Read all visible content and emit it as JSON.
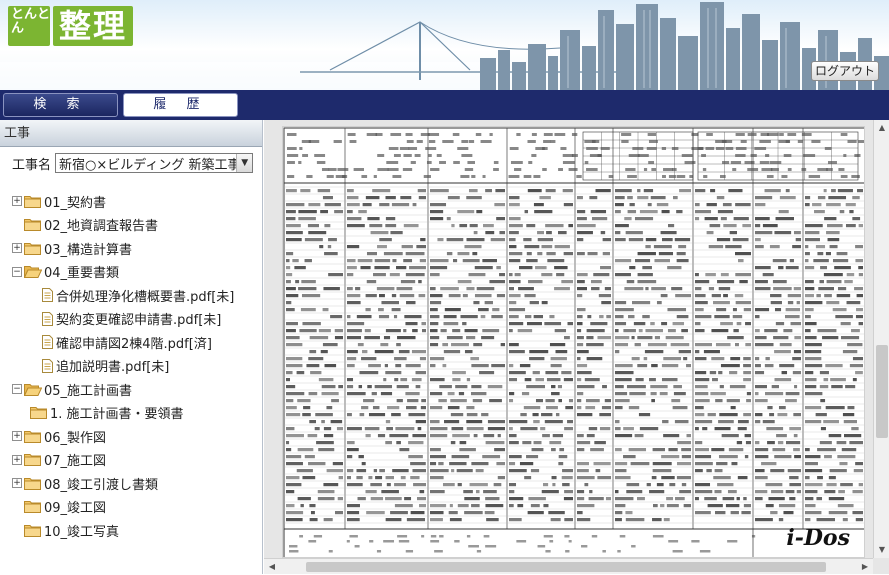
{
  "header": {
    "logo_sub": "とんとん",
    "logo_main": "整理",
    "logout_label": "ログアウト"
  },
  "tabs": {
    "search_label": "検 索",
    "history_label": "履 歴"
  },
  "panel": {
    "section_title": "工事",
    "project_label": "工事名",
    "project_value": "新宿○×ビルディング 新築工事"
  },
  "tree": [
    {
      "label": "01_契約書",
      "type": "folder",
      "expander": "+"
    },
    {
      "label": "02_地資調査報告書",
      "type": "folder",
      "expander": ""
    },
    {
      "label": "03_構造計算書",
      "type": "folder",
      "expander": "+"
    },
    {
      "label": "04_重要書類",
      "type": "folder-open",
      "expander": "-"
    },
    {
      "label": "合併処理浄化槽概要書.pdf[未]",
      "type": "file",
      "expander": ""
    },
    {
      "label": "契約変更確認申請書.pdf[未]",
      "type": "file",
      "expander": ""
    },
    {
      "label": "確認申請図2棟4階.pdf[済]",
      "type": "file",
      "expander": ""
    },
    {
      "label": "追加説明書.pdf[未]",
      "type": "file",
      "expander": ""
    },
    {
      "label": "05_施工計画書",
      "type": "folder-open",
      "expander": "-"
    },
    {
      "label": "1. 施工計画書・要領書",
      "type": "folder",
      "expander": ""
    },
    {
      "label": "06_製作図",
      "type": "folder",
      "expander": "+"
    },
    {
      "label": "07_施工図",
      "type": "folder",
      "expander": "+"
    },
    {
      "label": "08_竣工引渡し書類",
      "type": "folder",
      "expander": "+"
    },
    {
      "label": "09_竣工図",
      "type": "folder",
      "expander": ""
    },
    {
      "label": "10_竣工写真",
      "type": "folder",
      "expander": ""
    }
  ],
  "viewer": {
    "brand": "i-Dos"
  },
  "colors": {
    "navy": "#1e2a6c",
    "logo_green": "#7cb532",
    "folder": "#f3c86a"
  }
}
